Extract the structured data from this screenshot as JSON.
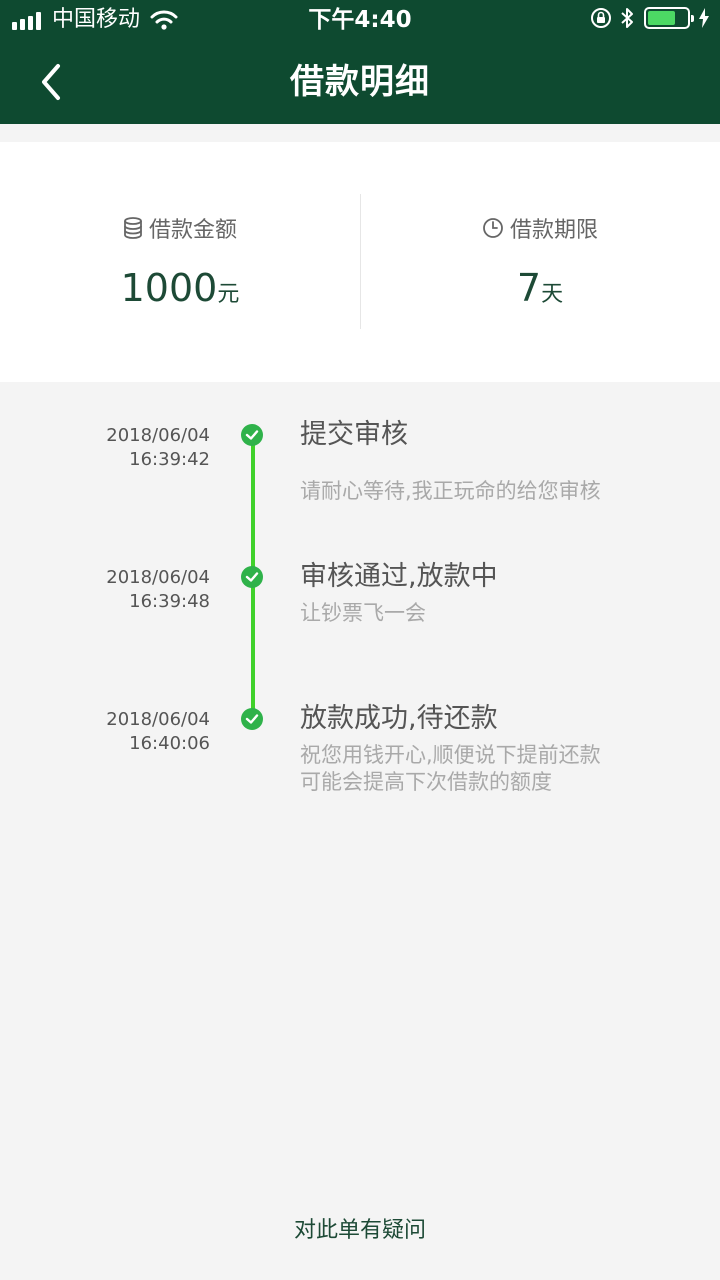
{
  "status_bar": {
    "carrier": "中国移动",
    "time": "下午4:40",
    "battery_level": 0.7,
    "accent_color": "#0e4a30"
  },
  "nav": {
    "title": "借款明细",
    "back_icon": "chevron-left-icon"
  },
  "summary": {
    "amount": {
      "label": "借款金额",
      "value": "1000",
      "unit": "元",
      "icon": "coins-icon"
    },
    "term": {
      "label": "借款期限",
      "value": "7",
      "unit": "天",
      "icon": "clock-icon"
    }
  },
  "timeline": {
    "line_color": "#3fd12a",
    "dot_color": "#2fb24a",
    "steps": [
      {
        "date": "2018/06/04",
        "time": "16:39:42",
        "title": "提交审核",
        "desc": [
          "请耐心等待,我正玩命的给您审核"
        ]
      },
      {
        "date": "2018/06/04",
        "time": "16:39:48",
        "title": "审核通过,放款中",
        "desc": [
          "让钞票飞一会"
        ]
      },
      {
        "date": "2018/06/04",
        "time": "16:40:06",
        "title": "放款成功,待还款",
        "desc": [
          "祝您用钱开心,顺便说下提前还款",
          "可能会提高下次借款的额度"
        ]
      }
    ]
  },
  "footer": {
    "help_label": "对此单有疑问"
  }
}
